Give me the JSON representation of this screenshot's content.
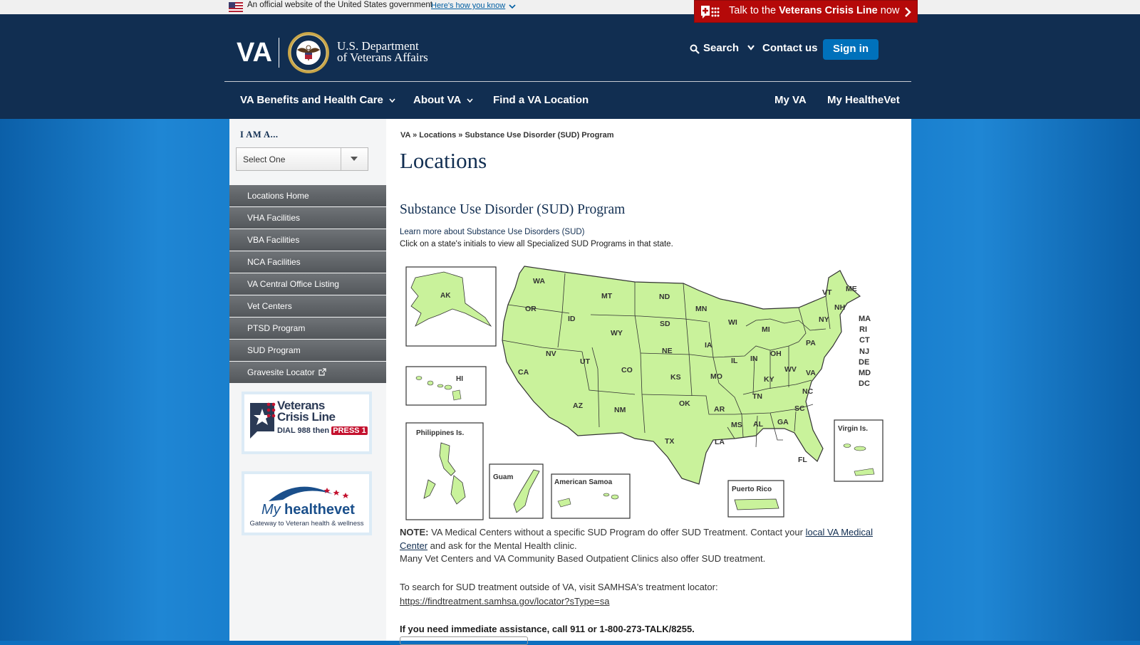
{
  "gov_banner": {
    "text": "An official website of the United States government",
    "link": "Here's how you know"
  },
  "crisis_line": {
    "prefix": "Talk to the ",
    "strong": "Veterans Crisis Line",
    "suffix": " now"
  },
  "header": {
    "logo": "VA",
    "dept_line1": "U.S. Department",
    "dept_line2": "of Veterans Affairs",
    "search": "Search",
    "contact": "Contact us",
    "signin": "Sign in"
  },
  "nav": {
    "benefits": "VA Benefits and Health Care",
    "about": "About VA",
    "find": "Find a VA Location",
    "myva": "My VA",
    "mhv": "My HealtheVet"
  },
  "sidebar": {
    "iam": "I AM A...",
    "select_value": "Select One",
    "menu": [
      "Locations Home",
      "VHA Facilities",
      "VBA Facilities",
      "NCA Facilities",
      "VA Central Office Listing",
      "Vet Centers",
      "PTSD Program",
      "SUD Program",
      "Gravesite Locator"
    ],
    "vcl_line1": "Veterans",
    "vcl_line2": "Crisis Line",
    "vcl_dial": "DIAL 988 then ",
    "vcl_press": "PRESS 1",
    "mhv_my": "My",
    "mhv_name": "healthevet",
    "mhv_tag": "Gateway to Veteran health & wellness"
  },
  "main": {
    "breadcrumb": "VA » Locations » Substance Use Disorder (SUD) Program",
    "title": "Locations",
    "subtitle": "Substance Use Disorder (SUD) Program",
    "learn_link": "Learn more about Substance Use Disorders (SUD)",
    "instruction": "Click on a state's initials to view all Specialized SUD Programs in that state.",
    "note_label": "NOTE:",
    "note_text": " VA Medical Centers without a specific SUD Program do offer SUD Treatment. Contact your ",
    "note_link": "local VA Medical Center",
    "note_tail": " and ask for the Mental Health clinic.",
    "vet_centers": "Many Vet Centers and VA Community Based Outpatient Clinics also offer SUD treatment.",
    "samhsa_text": "To search for SUD treatment outside of VA, visit SAMHSA's treatment locator:",
    "samhsa_link": "https://findtreatment.samhsa.gov/locator?sType=sa",
    "emergency": "If you need immediate assistance, call 911 or 1-800-273-TALK/8255."
  },
  "map": {
    "fill": "#c9f29b",
    "state_labels": [
      "WA",
      "OR",
      "CA",
      "NV",
      "ID",
      "MT",
      "WY",
      "UT",
      "AZ",
      "CO",
      "NM",
      "ND",
      "SD",
      "NE",
      "KS",
      "OK",
      "TX",
      "MN",
      "IA",
      "MO",
      "AR",
      "LA",
      "WI",
      "IL",
      "MI",
      "IN",
      "OH",
      "KY",
      "TN",
      "MS",
      "AL",
      "GA",
      "FL",
      "SC",
      "NC",
      "VA",
      "WV",
      "PA",
      "NY",
      "VT",
      "NH",
      "ME"
    ],
    "east_labels": [
      "MA",
      "RI",
      "CT",
      "NJ",
      "DE",
      "MD",
      "DC"
    ],
    "insets": {
      "ak": "AK",
      "hi": "HI",
      "philippines": "Philippines Is.",
      "guam": "Guam",
      "samoa": "American Samoa",
      "puerto_rico": "Puerto Rico",
      "virgin": "Virgin Is."
    }
  }
}
